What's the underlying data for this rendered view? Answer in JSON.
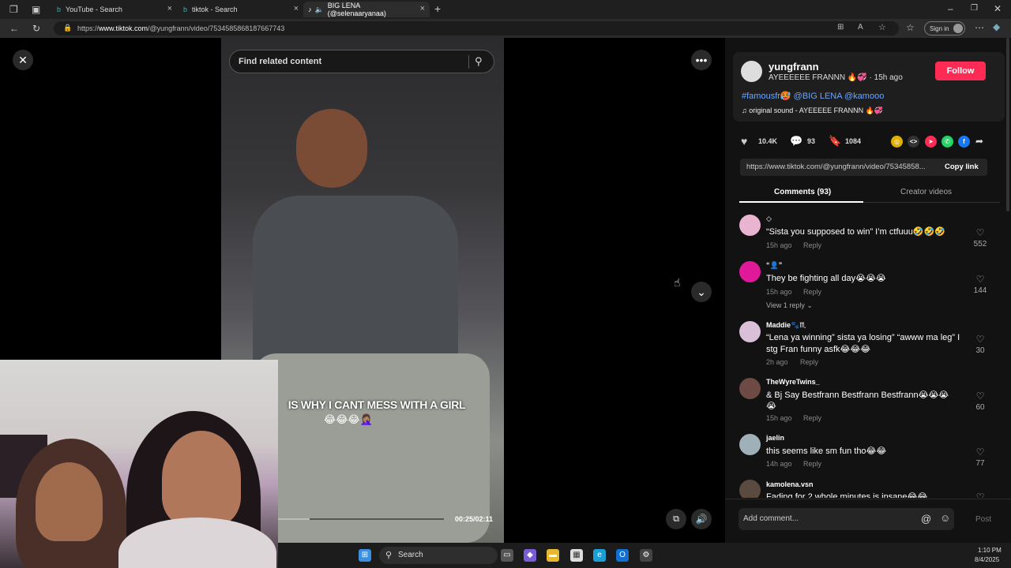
{
  "browser": {
    "tabs": [
      {
        "title": "YouTube - Search"
      },
      {
        "title": "tiktok - Search"
      },
      {
        "title": "BIG LENA (@selenaaryanaa)"
      }
    ],
    "url_prefix": "https://",
    "url_domain": "www.tiktok.com",
    "url_path": "/@yungfrann/video/7534585868187667743",
    "signin_label": "Sign in"
  },
  "player": {
    "search_placeholder": "Find related content",
    "caption": "IS WHY I CANT MESS WITH A GIRL",
    "caption_emoji": "😂😂😂🤦🏽‍♀️",
    "time": "00:25/02:11",
    "progress": 0.19
  },
  "post": {
    "username": "yungfrann",
    "subline": "AYEEEEEE FRANNN 🔥💞 · 15h ago",
    "follow_label": "Follow",
    "hashtags": "#famousfr🥵 @BIG LENA @kamooo",
    "sound": "♫  original sound - AYEEEEE FRANNN 🔥💞",
    "likes": "10.4K",
    "comments": "93",
    "saves": "1084",
    "link": "https://www.tiktok.com/@yungfrann/video/75345858...",
    "copy_link_label": "Copy link",
    "tab_comments": "Comments (93)",
    "tab_creator": "Creator videos"
  },
  "comments": [
    {
      "user": "◇",
      "text": "“Sista you supposed to win” I’m ctfuuu🤣🤣🤣",
      "time": "15h ago",
      "reply": "Reply",
      "likes": "552",
      "color": "#e8b4d0"
    },
    {
      "user": "“👤”",
      "text": "They be fighting all day😭😭😭",
      "time": "15h ago",
      "reply": "Reply",
      "likes": "144",
      "color": "#e0189a",
      "view_replies": "View 1 reply ⌄"
    },
    {
      "user": "Maddie🐾♏",
      "text": "“Lena ya winning” sista ya losing” “awww ma leg” I",
      "text2": "stg Fran funny asfk😂😂😂",
      "time": "2h ago",
      "reply": "Reply",
      "likes": "30",
      "color": "#d9c0d8"
    },
    {
      "user": "TheWyreTwins_",
      "text": "& Bj Say Bestfrann Bestfrann Bestfrann😭😭😭",
      "text2": "😭",
      "time": "15h ago",
      "reply": "Reply",
      "likes": "60",
      "color": "#6d4a44"
    },
    {
      "user": "jaelin",
      "text": "this seems like sm fun tho😂😂",
      "time": "14h ago",
      "reply": "Reply",
      "likes": "77",
      "color": "#9fb0b8"
    },
    {
      "user": "kamolena.vsn",
      "text": "Fading for 2 whole minutes is insane😂😂",
      "color": "#5a4a40"
    }
  ],
  "composer": {
    "placeholder": "Add comment...",
    "post_label": "Post"
  },
  "taskbar": {
    "search_label": "Search",
    "time": "1:10 PM",
    "date": "8/4/2025"
  },
  "icons": [
    "close-icon",
    "more-icon",
    "chevron-down-icon",
    "search-icon",
    "heart-icon",
    "comment-icon",
    "bookmark-icon",
    "share-icon",
    "volume-icon",
    "at-icon",
    "emoji-icon",
    "windows-icon"
  ]
}
